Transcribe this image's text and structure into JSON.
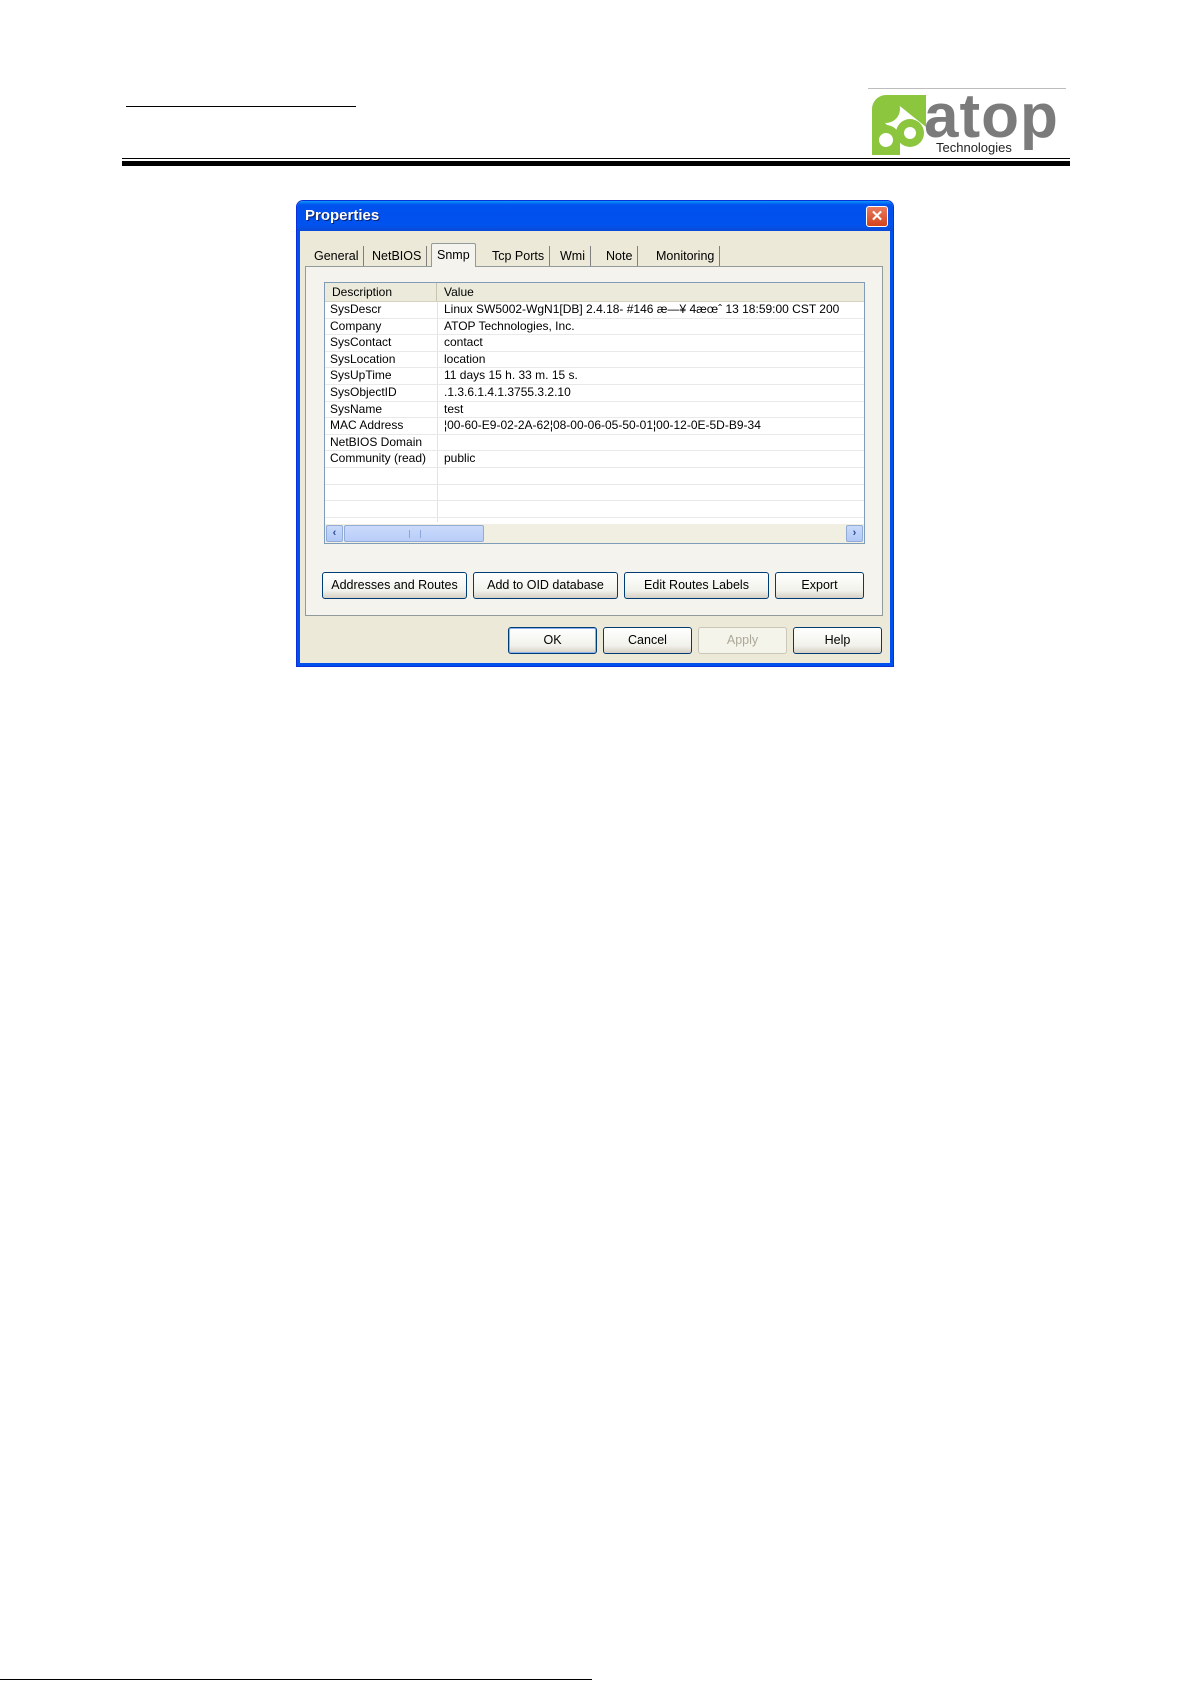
{
  "header": {
    "logo_text": "atop",
    "logo_subtext": "Technologies",
    "colors": {
      "logo_green": "#8cc63f",
      "logo_grey": "#7b7b7b"
    }
  },
  "dialog": {
    "title": "Properties",
    "close_icon": "close-icon",
    "tabs": [
      {
        "label": "General"
      },
      {
        "label": "NetBIOS"
      },
      {
        "label": "Snmp"
      },
      {
        "label": "Tcp Ports"
      },
      {
        "label": "Wmi"
      },
      {
        "label": "Note"
      },
      {
        "label": "Monitoring"
      }
    ],
    "active_tab": "Snmp",
    "list": {
      "columns": [
        "Description",
        "Value"
      ],
      "rows": [
        {
          "description": "SysDescr",
          "value": "Linux SW5002-WgN1[DB] 2.4.18- #146 æ—¥ 4æœˆ 13 18:59:00 CST 200"
        },
        {
          "description": "Company",
          "value": "ATOP Technologies, Inc."
        },
        {
          "description": "SysContact",
          "value": "contact"
        },
        {
          "description": "SysLocation",
          "value": "location"
        },
        {
          "description": "SysUpTime",
          "value": "11 days 15 h. 33 m. 15 s."
        },
        {
          "description": "SysObjectID",
          "value": ".1.3.6.1.4.1.3755.3.2.10"
        },
        {
          "description": "SysName",
          "value": "test"
        },
        {
          "description": "MAC Address",
          "value": "¦00-60-E9-02-2A-62¦08-00-06-05-50-01¦00-12-0E-5D-B9-34"
        },
        {
          "description": "NetBIOS Domain",
          "value": ""
        },
        {
          "description": "Community (read)",
          "value": "public"
        },
        {
          "description": "",
          "value": ""
        },
        {
          "description": "",
          "value": ""
        },
        {
          "description": "",
          "value": ""
        },
        {
          "description": "",
          "value": ""
        }
      ]
    },
    "panel_buttons": {
      "addresses": "Addresses and Routes",
      "add_oid": "Add to OID database",
      "edit_routes": "Edit Routes Labels",
      "export": "Export"
    },
    "footer_buttons": {
      "ok": "OK",
      "cancel": "Cancel",
      "apply": "Apply",
      "help": "Help"
    },
    "colors": {
      "titlebar": "#0053ee",
      "face": "#ece9d8"
    }
  }
}
